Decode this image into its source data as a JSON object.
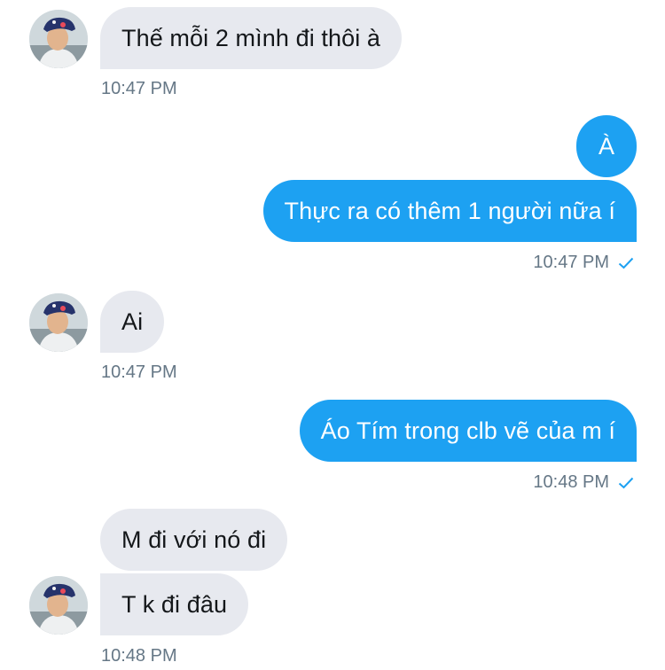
{
  "conversation": {
    "messages": [
      {
        "from": "other",
        "text": "Thế mỗi 2 mình đi thôi à"
      },
      {
        "from": "me",
        "text": "À"
      },
      {
        "from": "me",
        "text": "Thực ra có thêm 1 người nữa í"
      },
      {
        "from": "other",
        "text": "Ai"
      },
      {
        "from": "me",
        "text": "Áo Tím trong clb vẽ của m í"
      },
      {
        "from": "other",
        "text": "M đi với nó đi"
      },
      {
        "from": "other",
        "text": "T k đi đâu"
      }
    ],
    "timestamps": [
      "10:47 PM",
      "10:47 PM",
      "10:47 PM",
      "10:48 PM",
      "10:48 PM"
    ]
  },
  "icons": {
    "read_receipt": "check-icon",
    "avatar": "user-avatar"
  },
  "colors": {
    "outgoing_bubble": "#1da1f2",
    "incoming_bubble": "#e7e9ef",
    "timestamp": "#657786",
    "check": "#1da1f2"
  }
}
